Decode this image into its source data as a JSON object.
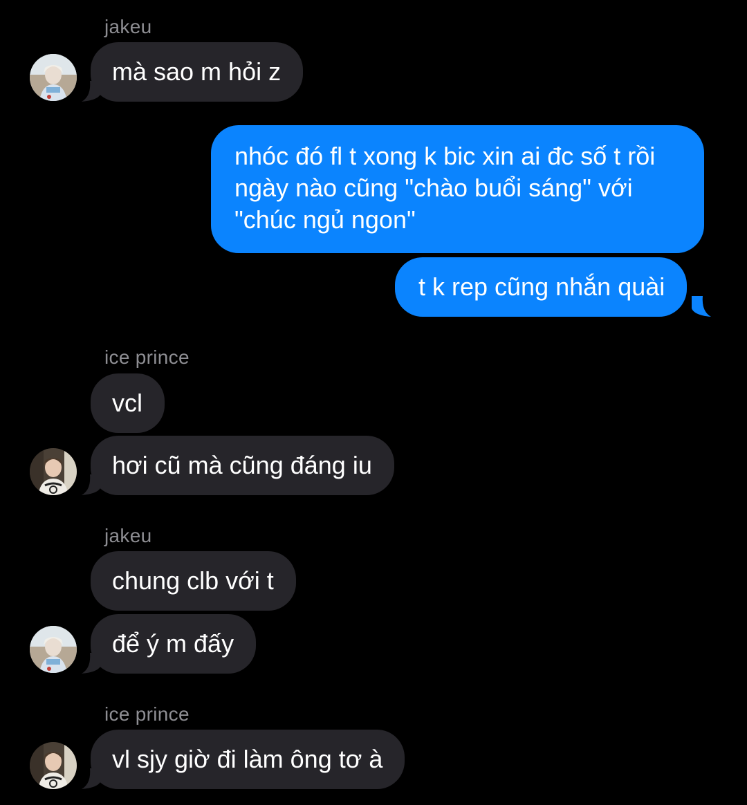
{
  "theme": {
    "background": "#000000",
    "incoming_bubble": "#26252a",
    "outgoing_bubble": "#0b84fe",
    "sender_name_color": "#8e8e93",
    "text_color": "#ffffff"
  },
  "messages": [
    {
      "sender": "jakeu",
      "direction": "incoming",
      "text": "mà sao m hỏi z",
      "show_name": true,
      "show_avatar": true,
      "avatar": "jakeu-avatar"
    },
    {
      "sender": "me",
      "direction": "outgoing",
      "text": "nhóc đó fl t xong k bic xin ai đc số t rồi ngày nào cũng \"chào buổi sáng\" với \"chúc ngủ ngon\""
    },
    {
      "sender": "me",
      "direction": "outgoing",
      "text": "t k rep cũng nhắn quài"
    },
    {
      "sender": "ice prince",
      "direction": "incoming",
      "text": "vcl",
      "show_name": true,
      "show_avatar": false
    },
    {
      "sender": "ice prince",
      "direction": "incoming",
      "text": "hơi cũ mà cũng đáng iu",
      "show_avatar": true,
      "avatar": "ice-prince-avatar"
    },
    {
      "sender": "jakeu",
      "direction": "incoming",
      "text": "chung clb với t",
      "show_name": true,
      "show_avatar": false
    },
    {
      "sender": "jakeu",
      "direction": "incoming",
      "text": "để ý m đấy",
      "show_avatar": true,
      "avatar": "jakeu-avatar"
    },
    {
      "sender": "ice prince",
      "direction": "incoming",
      "text": "vl sjy giờ đi làm ông tơ à",
      "show_name": true,
      "show_avatar": true,
      "avatar": "ice-prince-avatar"
    }
  ],
  "outgoing_lines": [
    "nhóc đó fl t xong k bic xin ai đc số t rồi",
    "ngày nào cũng \"chào buổi sáng\" với",
    "\"chúc ngủ ngon\""
  ]
}
